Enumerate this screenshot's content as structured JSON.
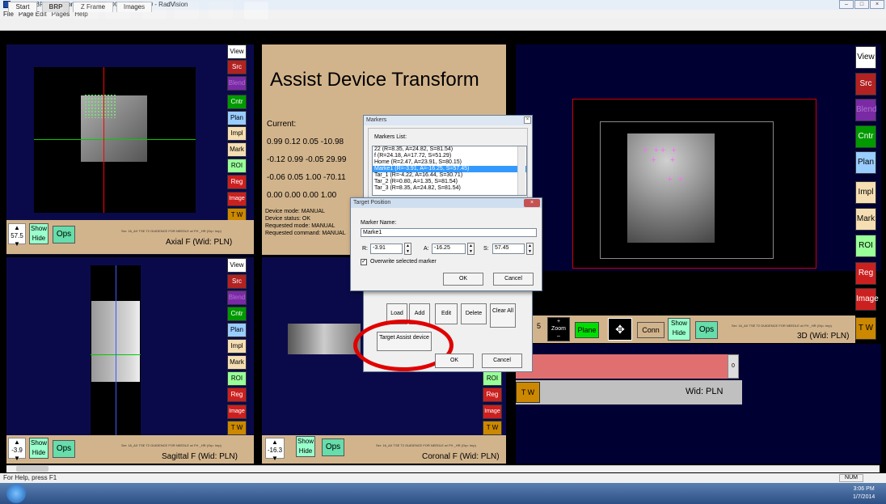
{
  "window": {
    "title": "Name: BRP Phantom  Id: exp001  DOB: 1/1/2000 - RadVision",
    "menu": [
      "File",
      "Page Edit",
      "Pages",
      "Help"
    ]
  },
  "tabs": [
    "Start",
    "BRP",
    "Z Frame",
    "Images"
  ],
  "side_buttons": {
    "view": "View",
    "src": "Src",
    "blend": "Blend",
    "cntr": "Cntr",
    "plan": "Plan",
    "impl": "Impl",
    "mark": "Mark",
    "roi": "ROI",
    "reg": "Reg",
    "image": "Image",
    "tw": "T W"
  },
  "axial": {
    "spin_value": "57.5",
    "show": "Show",
    "hide": "Hide",
    "ops": "Ops",
    "caption": "Axial F (Wid: PLN)",
    "series": "Ser: 16_AX TSE T2 GUIDENCE FOR NEEDLE w/ FH _HR (Grp: Imp)"
  },
  "sagittal": {
    "spin_value": "-3.9",
    "show": "Show",
    "hide": "Hide",
    "ops": "Ops",
    "caption": "Sagittal F (Wid: PLN)",
    "series": "Ser: 16_AX TSE T2 GUIDENCE FOR NEEDLE w/ FH _HR (Grp: Imp)"
  },
  "coronal": {
    "spin_value": "-16.3",
    "show": "Show",
    "hide": "Hide",
    "ops": "Ops",
    "caption": "Coronal F (Wid: PLN)",
    "series": "Ser: 16_AX TSE T2 GUIDENCE FOR NEEDLE w/ FH _HR (Grp: Imp)"
  },
  "threeD": {
    "caption": "3D (Wid: PLN)",
    "zoom": "Zoom",
    "plane": "Plane",
    "conn": "Conn",
    "show": "Show",
    "hide": "Hide",
    "ops": "Ops",
    "partial": "5",
    "tw": "T W",
    "wid": "Wid: PLN",
    "scroll_value": "0",
    "series": "Ser: 16_AX TSE T2 GUIDENCE FOR NEEDLE w/ FH _HR (Grp: Imp)"
  },
  "transform": {
    "title": "Assist Device Transform",
    "current_label": "Current:",
    "rows": [
      "0.99 0.12 0.05 -10.98",
      "-0.12 0.99 -0.05 29.99",
      "-0.06 0.05 1.00 -70.11",
      "0.00 0.00 0.00 1.00"
    ],
    "device_mode": "Device mode: MANUAL",
    "device_status": "Device status: OK",
    "requested_mode": "Requested mode: MANUAL",
    "requested_command": "Requested command: MANUAL"
  },
  "markers_dialog": {
    "title": "Markers",
    "list_label": "Markers List:",
    "items": [
      "22 (R=8.35, A=24.82, S=81.54)",
      "f (R=24.18, A=17.72, S=51.29)",
      "Home (R=2.47, A=23.91, S=80.15)",
      "Marke1 (R=-3.91, A=-16.25, S=57.45)",
      "Tar_1 (R=-4.22, A=16.44, S=30.71)",
      "Tar_2 (R=0.80, A=1.35, S=81.54)",
      "Tar_3 (R=8.35, A=24.82, S=81.54)"
    ],
    "selected_index": 3,
    "load": "Load",
    "add": "Add",
    "edit": "Edit",
    "delete": "Delete",
    "clear_all": "Clear All",
    "target_assist": "Target Assist device",
    "ok": "OK",
    "cancel": "Cancel"
  },
  "target_dialog": {
    "title": "Target Position",
    "name_label": "Marker Name:",
    "name_value": "Marke1",
    "r_label": "R:",
    "r_value": "-3.91",
    "a_label": "A:",
    "a_value": "-16.25",
    "s_label": "S:",
    "s_value": "57.45",
    "overwrite_label": "Overwrite selected marker",
    "overwrite_checked": true,
    "ok": "OK",
    "cancel": "Cancel"
  },
  "status": {
    "help": "For Help, press F1",
    "num": "NUM"
  },
  "taskbar": {
    "time": "3:06 PM",
    "date": "1/7/2014"
  },
  "colors": {
    "highlight": "#3399ff",
    "circle": "#e00000",
    "panel_bg": "#d2b48c",
    "view_bg": "#000033"
  }
}
